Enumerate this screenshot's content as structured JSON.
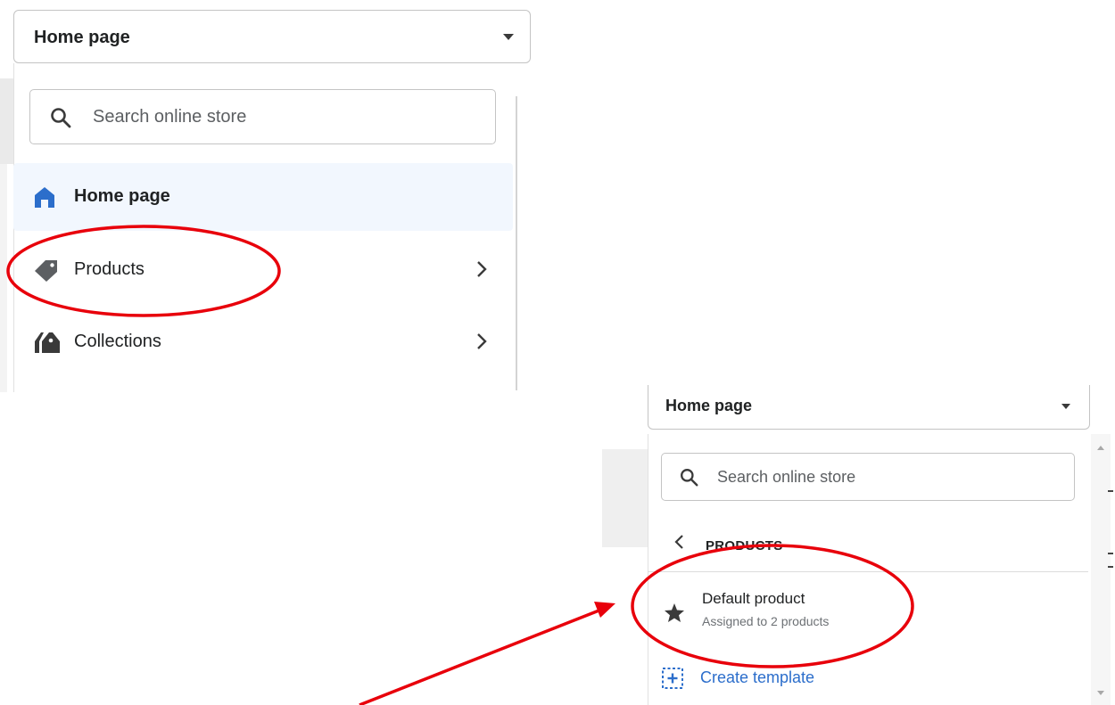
{
  "panel_top": {
    "dropdown": {
      "label": "Home page"
    },
    "search": {
      "placeholder": "Search online store"
    },
    "items": [
      {
        "label": "Home page",
        "icon": "home-icon",
        "active": true
      },
      {
        "label": "Products",
        "icon": "tag-icon",
        "has_children": true
      },
      {
        "label": "Collections",
        "icon": "collections-icon",
        "has_children": true
      }
    ]
  },
  "panel_bottom": {
    "dropdown": {
      "label": "Home page"
    },
    "search": {
      "placeholder": "Search online store"
    },
    "section_title": "PRODUCTS",
    "template": {
      "title": "Default product",
      "subtitle": "Assigned to 2 products",
      "icon": "star-icon"
    },
    "create_template_label": "Create template"
  },
  "colors": {
    "accent": "#2c6ecb",
    "active_bg": "#f2f7fe",
    "annotation": "#e8000b"
  }
}
